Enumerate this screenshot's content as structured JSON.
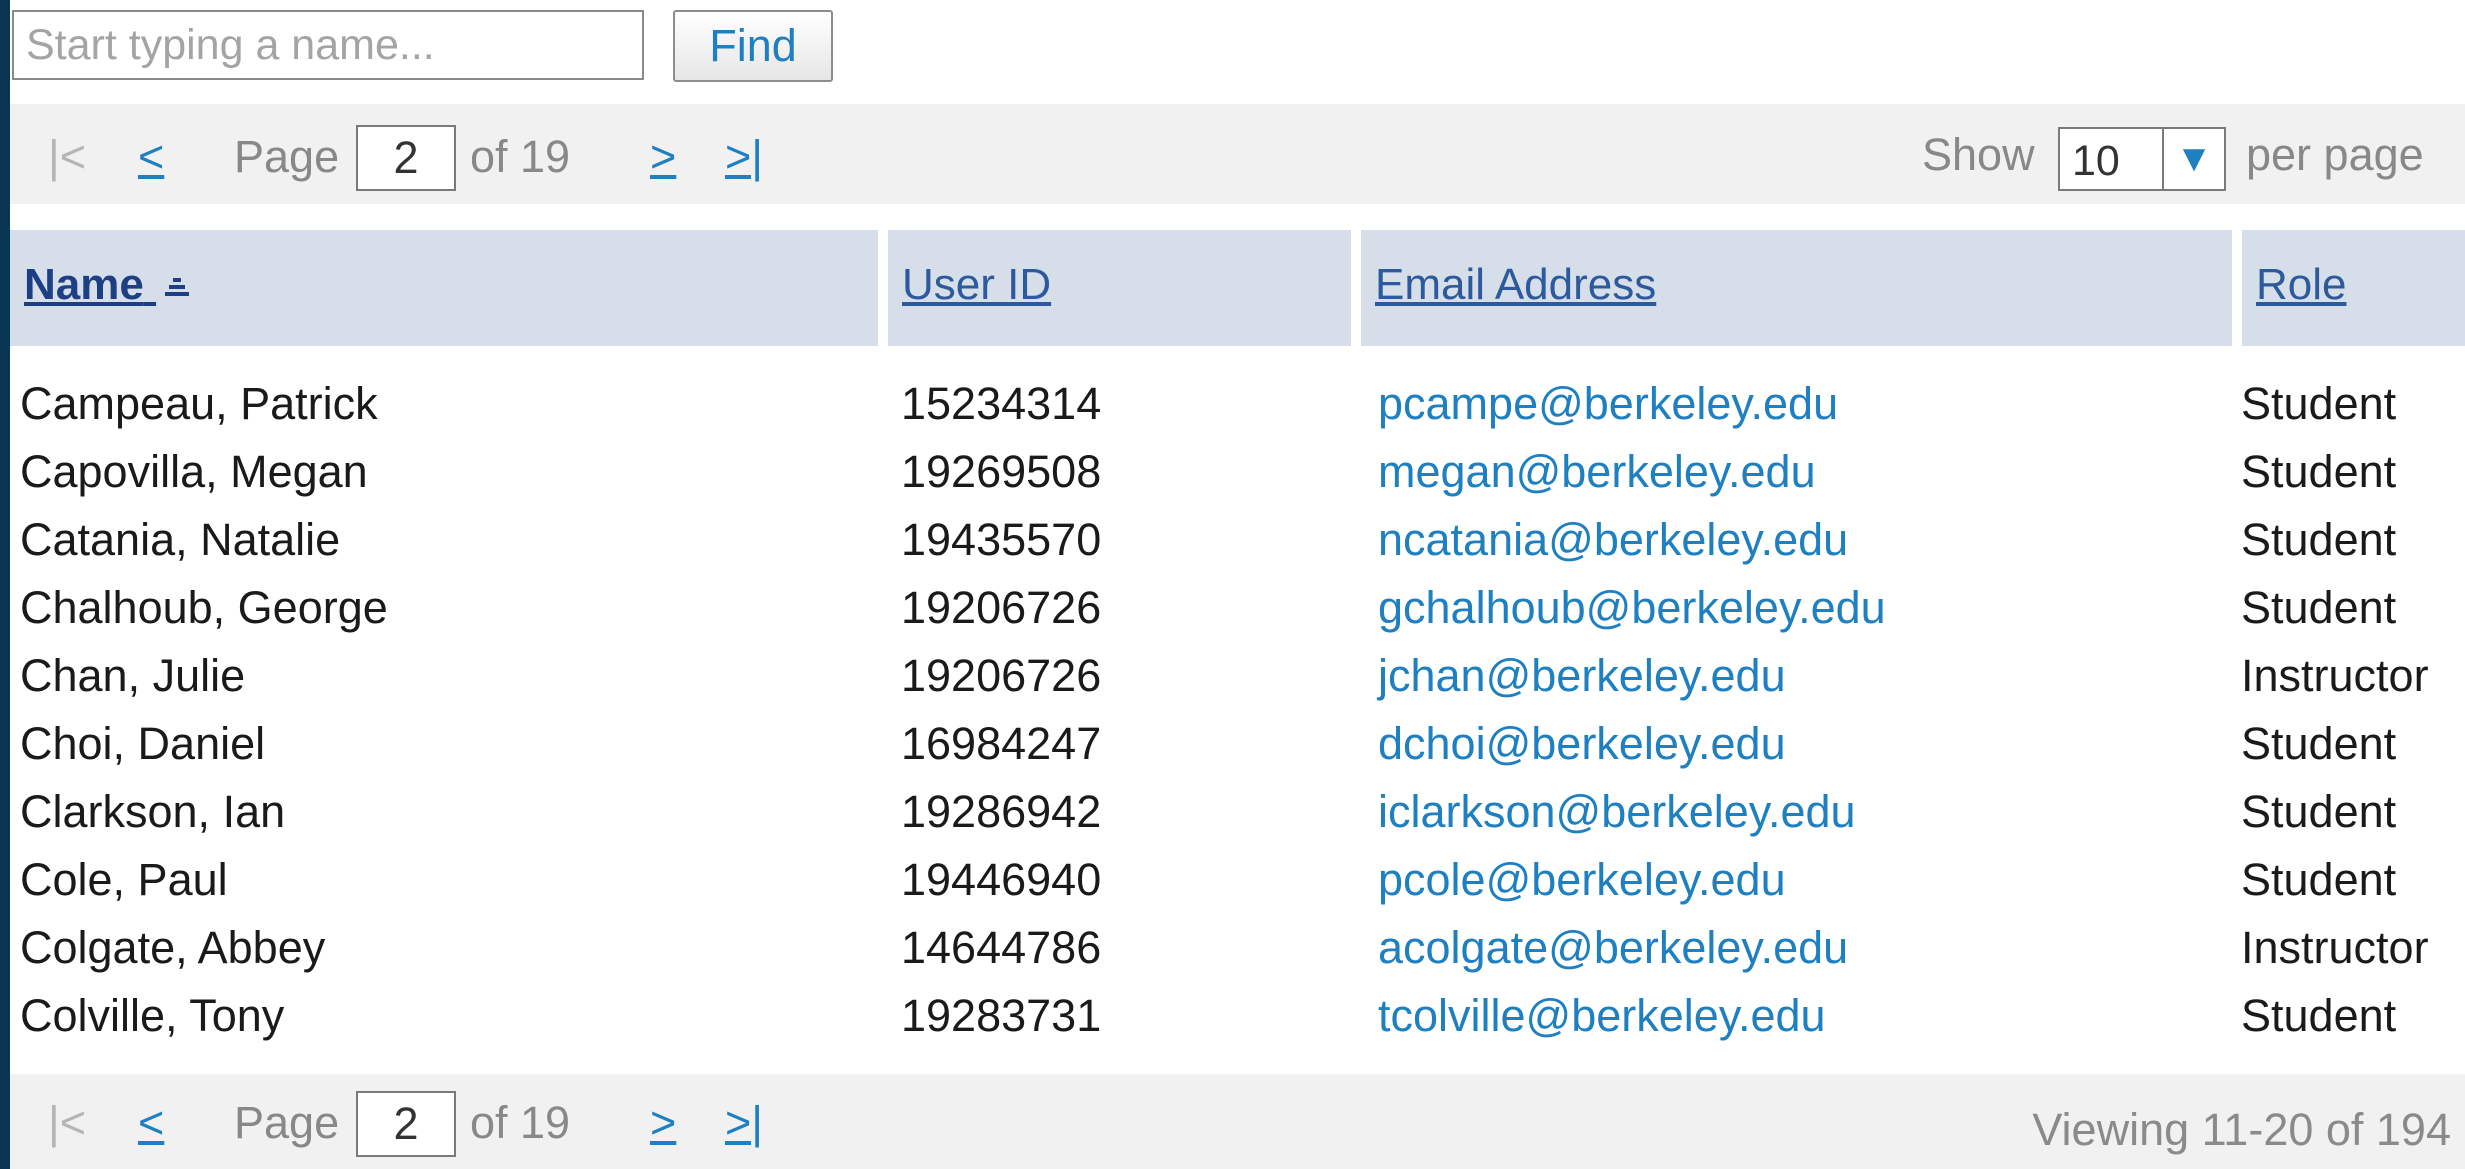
{
  "search": {
    "placeholder": "Start typing a name...",
    "find_label": "Find"
  },
  "pager": {
    "first_label": "|<",
    "prev_label": "<",
    "page_label": "Page",
    "current_page": "2",
    "of_label": "of 19",
    "next_label": ">",
    "last_label": ">|",
    "show_label": "Show",
    "per_page_value": "10",
    "per_page_suffix": "per page",
    "viewing_summary": "Viewing 11-20 of 194"
  },
  "table": {
    "columns": [
      {
        "label": "Name",
        "sorted": "ascending"
      },
      {
        "label": "User ID"
      },
      {
        "label": "Email Address"
      },
      {
        "label": "Role"
      }
    ],
    "rows": [
      {
        "name": "Campeau, Patrick",
        "user_id": "15234314",
        "email": "pcampe@berkeley.edu",
        "role": "Student"
      },
      {
        "name": "Capovilla, Megan",
        "user_id": "19269508",
        "email": "megan@berkeley.edu",
        "role": "Student"
      },
      {
        "name": "Catania, Natalie",
        "user_id": "19435570",
        "email": "ncatania@berkeley.edu",
        "role": "Student"
      },
      {
        "name": "Chalhoub, George",
        "user_id": "19206726",
        "email": "gchalhoub@berkeley.edu",
        "role": "Student"
      },
      {
        "name": "Chan, Julie",
        "user_id": "19206726",
        "email": "jchan@berkeley.edu",
        "role": "Instructor"
      },
      {
        "name": "Choi, Daniel",
        "user_id": "16984247",
        "email": "dchoi@berkeley.edu",
        "role": "Student"
      },
      {
        "name": "Clarkson, Ian",
        "user_id": "19286942",
        "email": "iclarkson@berkeley.edu",
        "role": "Student"
      },
      {
        "name": "Cole, Paul",
        "user_id": "19446940",
        "email": "pcole@berkeley.edu",
        "role": "Student"
      },
      {
        "name": "Colgate, Abbey",
        "user_id": "14644786",
        "email": "acolgate@berkeley.edu",
        "role": "Instructor"
      },
      {
        "name": "Colville, Tony",
        "user_id": "19283731",
        "email": "tcolville@berkeley.edu",
        "role": "Student"
      }
    ]
  },
  "colors": {
    "link": "#1e7fc1",
    "header_bg": "#d5dee9",
    "header_text": "#2c5a9c",
    "pager_bg": "#f1f1f1",
    "page_border": "#083653"
  },
  "icons": {
    "sort": "sort-ascending-icon",
    "dropdown": "triangle-down-icon"
  }
}
